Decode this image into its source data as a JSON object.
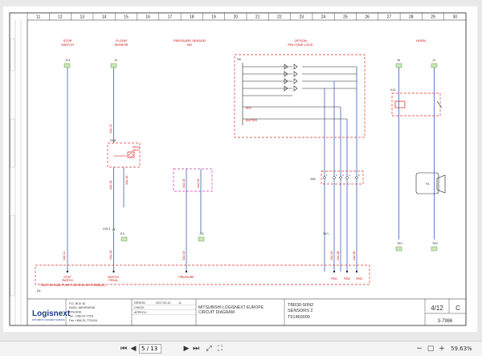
{
  "columns": [
    "11",
    "12",
    "13",
    "14",
    "15",
    "16",
    "17",
    "18",
    "19",
    "20",
    "21",
    "22",
    "23",
    "24",
    "25",
    "26",
    "27",
    "28",
    "29",
    "30"
  ],
  "headings": {
    "stop_switch": [
      "STOP",
      "SWITCH"
    ],
    "floor_sensor": [
      "FLOOR",
      "SENSOR"
    ],
    "pressure_sensor": [
      "PRESSURE SENSOR",
      "NH"
    ],
    "option_pin": [
      "OPTION",
      "PIN CODE LOCK"
    ],
    "horn": "HORN"
  },
  "components": {
    "s18": "S18",
    "b1": "B1",
    "b1_label": [
      "RIGHT",
      "PROX"
    ],
    "s6": "S6",
    "k11": "K11",
    "horn_h1": "H1",
    "xb6": "XB6",
    "a1": "A1",
    "bus_label": "TRACTION AND PUMP CONTROLLER COMBI(AC)"
  },
  "labels": {
    "j14": "J14",
    "j4": "J4",
    "j6": "J6",
    "j1": "J1",
    "x25": "X25:3",
    "j13": "J13",
    "j32": "J32",
    "xa1_11": "XA1:11",
    "xa1_18": "XA1:18",
    "xa1_13": "XA1:13",
    "xa1_23": "XA1:23",
    "xa1_28": "XA1:28",
    "xa1_35": "XA1:35",
    "pressure": "PRESSURE",
    "switch_pedal": [
      "SWITCH",
      "PEDAL"
    ],
    "stop_switch2": [
      "STOP",
      "SWITCH"
    ],
    "pin1": "PIN1",
    "pin2": "PIN2",
    "pin3": "PIN3",
    "l13": "TA/1",
    "l14": "TA/2",
    "ppc": "PPC",
    "entter": "ENTTER",
    "xb6_pins": [
      "1",
      "2",
      "3",
      "4",
      "5"
    ]
  },
  "title_block": {
    "company": "Logisnext",
    "company_sub": "MITSUBISHI LOGISNEXT EUROPE",
    "address": [
      "P.O. BOX 30",
      "04401 JÄRVENPÄÄ",
      "FINLAND",
      "Tel. +358-20-77511",
      "Fax +358-20-7751116"
    ],
    "rows": [
      {
        "k": "DESIGN",
        "d": "2017-03-10",
        "n": "JL"
      },
      {
        "k": "CHECK.",
        "d": "",
        "n": ""
      },
      {
        "k": "APPROV.",
        "d": "",
        "n": ""
      }
    ],
    "doc_title": [
      "MITSUBISHI LOGISNEXT EUROPE",
      "CIRCUIT DIAGRAM"
    ],
    "model": "TBR30-50N2",
    "sheet_name": "SENSORS 2",
    "doc_no": "T51460000",
    "sheet": "4/12",
    "rev": "C",
    "ref": "3-7986"
  },
  "toolbar": {
    "page_value": "5 / 13",
    "zoom": "59.63%"
  }
}
